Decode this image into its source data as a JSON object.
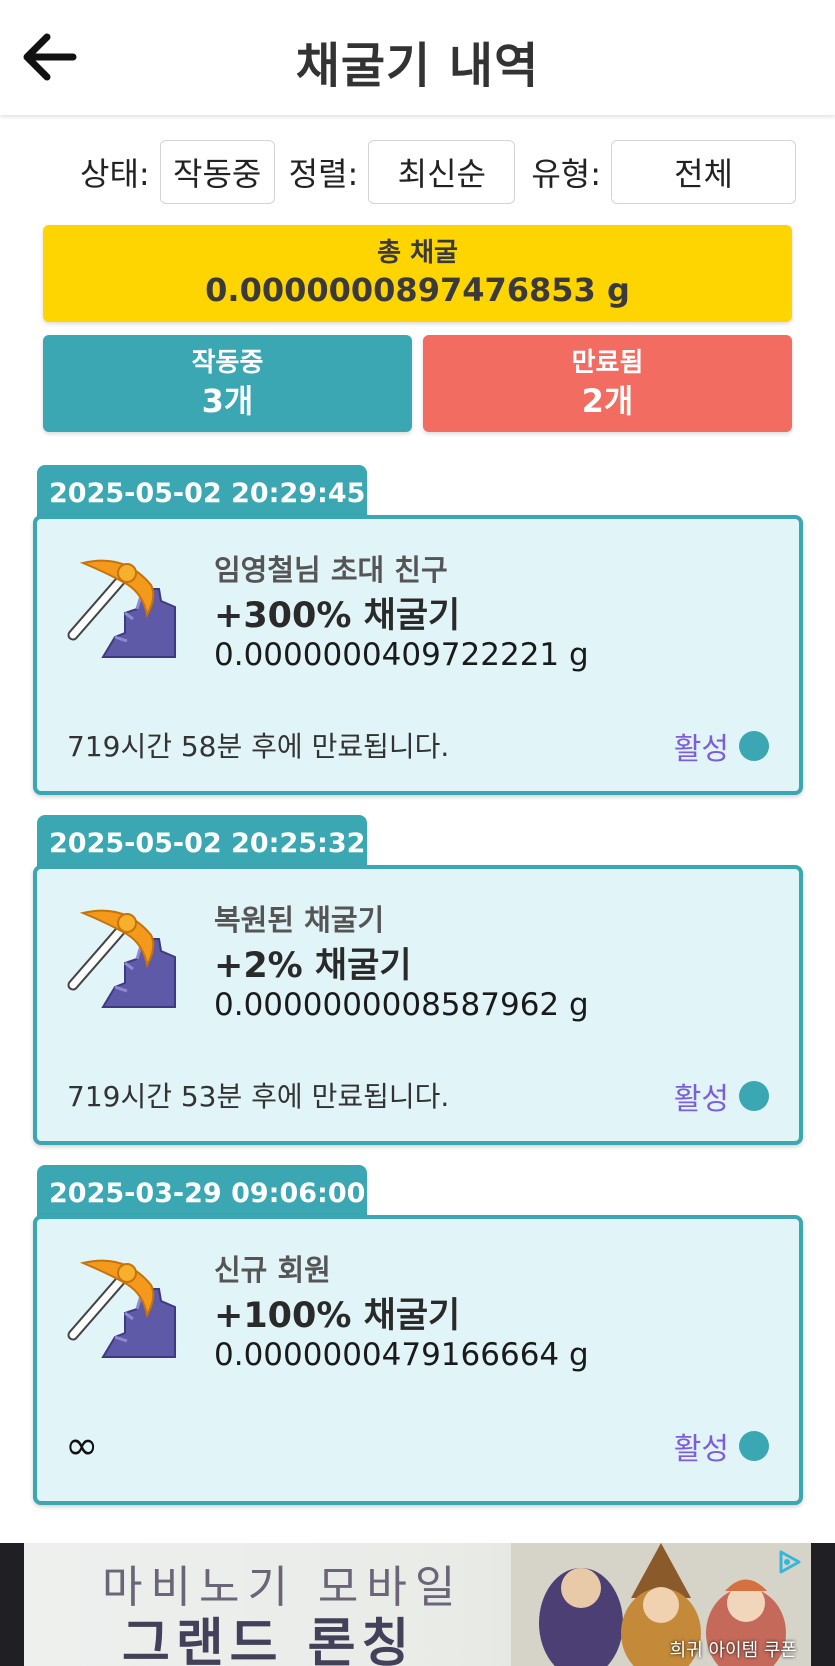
{
  "header": {
    "title": "채굴기 내역"
  },
  "filters": {
    "status": {
      "label": "상태:",
      "value": "작동중"
    },
    "sort": {
      "label": "정렬:",
      "value": "최신순"
    },
    "type": {
      "label": "유형:",
      "value": "전체"
    }
  },
  "total": {
    "label": "총 채굴",
    "value": "0.0000000897476853 g"
  },
  "stats": {
    "active": {
      "label": "작동중",
      "value": "3개"
    },
    "expired": {
      "label": "만료됨",
      "value": "2개"
    }
  },
  "colors": {
    "teal": "#3ba7b2",
    "yellow": "#fed500",
    "red": "#f26c62",
    "card_bg": "#e1f5f8",
    "status_purple": "#7e5dd8"
  },
  "cards": [
    {
      "date": "2025-05-02 20:29:45",
      "name": "임영철님 초대 친구",
      "title": "+300% 채굴기",
      "amount": "0.0000000409722221 g",
      "expire": "719시간 58분 후에 만료됩니다.",
      "status": "활성",
      "icon": "pickaxe-icon"
    },
    {
      "date": "2025-05-02 20:25:32",
      "name": "복원된 채굴기",
      "title": "+2% 채굴기",
      "amount": "0.0000000008587962 g",
      "expire": "719시간 53분 후에 만료됩니다.",
      "status": "활성",
      "icon": "pickaxe-icon"
    },
    {
      "date": "2025-03-29 09:06:00",
      "name": "신규 회원",
      "title": "+100% 채굴기",
      "amount": "0.0000000479166664 g",
      "expire": "∞",
      "status": "활성",
      "icon": "pickaxe-icon"
    }
  ],
  "ad": {
    "line1": "마비노기 모바일",
    "line2": "그랜드 론칭",
    "small": "희귀 아이템 쿠폰"
  }
}
